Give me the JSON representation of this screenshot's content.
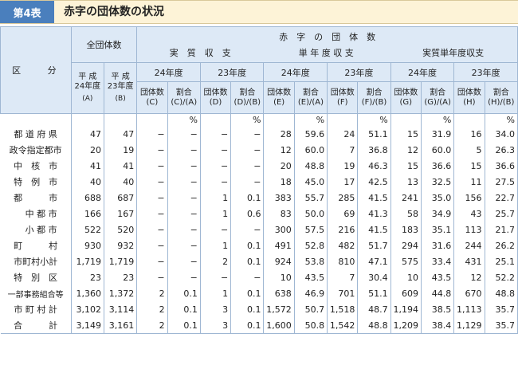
{
  "header": {
    "tag": "第4表",
    "title": "赤字の団体数の状況"
  },
  "columns": {
    "kubun": "区　　分",
    "all_groups": "全団体数",
    "all_fy24": "平 成\n24年度",
    "all_fy23": "平 成\n23年度",
    "all_a": "(A)",
    "all_b": "(B)",
    "deficit_title": "赤　字　の　団　体　数",
    "jisshitsu": "実　質　収　支",
    "tannendo": "単 年 度 収 支",
    "jisshitsu_tannendo": "実質単年度収支",
    "fy24": "24年度",
    "fy23": "23年度",
    "dantaisu_c": "団体数\n(C)",
    "wariai_ca": "割合\n(C)/(A)",
    "dantaisu_d": "団体数\n(D)",
    "wariai_db": "割合\n(D)/(B)",
    "dantaisu_e": "団体数\n(E)",
    "wariai_ea": "割合\n(E)/(A)",
    "dantaisu_f": "団体数\n(F)",
    "wariai_fb": "割合\n(F)/(B)",
    "dantaisu_g": "団体数\n(G)",
    "wariai_ga": "割合\n(G)/(A)",
    "dantaisu_h": "団体数\n(H)",
    "wariai_hb": "割合\n(H)/(B)",
    "pct": "%"
  },
  "rows": [
    [
      "都 道 府 県",
      "47",
      "47",
      "−",
      "−",
      "−",
      "−",
      "28",
      "59.6",
      "24",
      "51.1",
      "15",
      "31.9",
      "16",
      "34.0"
    ],
    [
      "政令指定都市",
      "20",
      "19",
      "−",
      "−",
      "−",
      "−",
      "12",
      "60.0",
      "7",
      "36.8",
      "12",
      "60.0",
      "5",
      "26.3"
    ],
    [
      "中　核　市",
      "41",
      "41",
      "−",
      "−",
      "−",
      "−",
      "20",
      "48.8",
      "19",
      "46.3",
      "15",
      "36.6",
      "15",
      "36.6"
    ],
    [
      "特　例　市",
      "40",
      "40",
      "−",
      "−",
      "−",
      "−",
      "18",
      "45.0",
      "17",
      "42.5",
      "13",
      "32.5",
      "11",
      "27.5"
    ],
    [
      "都　　　市",
      "688",
      "687",
      "−",
      "−",
      "1",
      "0.1",
      "383",
      "55.7",
      "285",
      "41.5",
      "241",
      "35.0",
      "156",
      "22.7"
    ],
    [
      "中 都 市",
      "166",
      "167",
      "−",
      "−",
      "1",
      "0.6",
      "83",
      "50.0",
      "69",
      "41.3",
      "58",
      "34.9",
      "43",
      "25.7"
    ],
    [
      "小 都 市",
      "522",
      "520",
      "−",
      "−",
      "−",
      "−",
      "300",
      "57.5",
      "216",
      "41.5",
      "183",
      "35.1",
      "113",
      "21.7"
    ],
    [
      "町　　　村",
      "930",
      "932",
      "−",
      "−",
      "1",
      "0.1",
      "491",
      "52.8",
      "482",
      "51.7",
      "294",
      "31.6",
      "244",
      "26.2"
    ],
    [
      "市町村小計",
      "1,719",
      "1,719",
      "−",
      "−",
      "2",
      "0.1",
      "924",
      "53.8",
      "810",
      "47.1",
      "575",
      "33.4",
      "431",
      "25.1"
    ],
    [
      "特　別　区",
      "23",
      "23",
      "−",
      "−",
      "−",
      "−",
      "10",
      "43.5",
      "7",
      "30.4",
      "10",
      "43.5",
      "12",
      "52.2"
    ],
    [
      "一部事務組合等",
      "1,360",
      "1,372",
      "2",
      "0.1",
      "1",
      "0.1",
      "638",
      "46.9",
      "701",
      "51.1",
      "609",
      "44.8",
      "670",
      "48.8"
    ],
    [
      "市 町 村 計",
      "3,102",
      "3,114",
      "2",
      "0.1",
      "3",
      "0.1",
      "1,572",
      "50.7",
      "1,518",
      "48.7",
      "1,194",
      "38.5",
      "1,113",
      "35.7"
    ],
    [
      "合　　　計",
      "3,149",
      "3,161",
      "2",
      "0.1",
      "3",
      "0.1",
      "1,600",
      "50.8",
      "1,542",
      "48.8",
      "1,209",
      "38.4",
      "1,129",
      "35.7"
    ]
  ],
  "colors": {
    "tag_bg": "#4a7fbd",
    "header_bg": "#fdf3d7",
    "thead_bg": "#dde9f6",
    "border": "#9fb7d3"
  }
}
